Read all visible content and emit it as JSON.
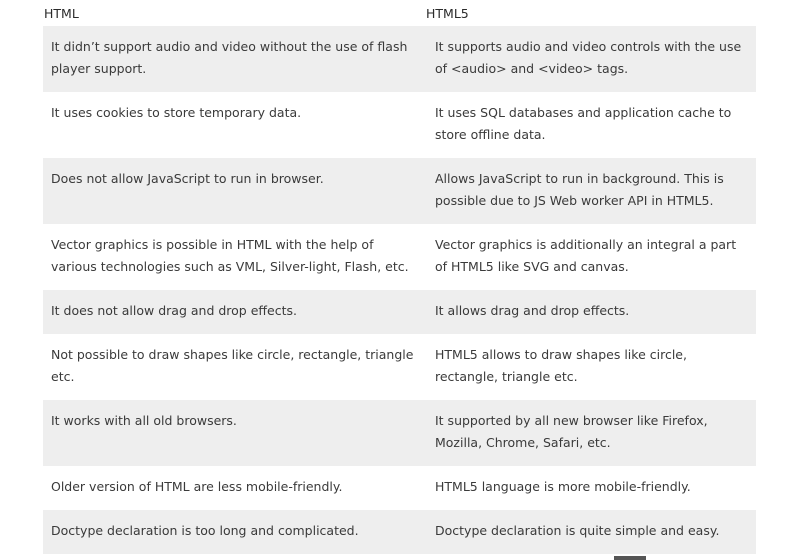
{
  "table": {
    "headers": [
      "HTML",
      "HTML5"
    ],
    "rows": [
      [
        "It didn’t support audio and video without the use of flash player support.",
        "It supports audio and video controls with the use of <audio> and <video> tags."
      ],
      [
        "It uses cookies to store temporary data.",
        "It uses SQL databases and application cache to store offline data."
      ],
      [
        "Does not allow JavaScript to run in browser.",
        "Allows JavaScript to run in background. This is possible due to JS Web worker API in HTML5."
      ],
      [
        "Vector graphics is possible in HTML with the help of various technologies such as VML, Silver-light, Flash, etc.",
        "Vector graphics is additionally an integral a part of HTML5 like SVG and canvas."
      ],
      [
        "It does not allow drag and drop effects.",
        "It allows drag and drop effects."
      ],
      [
        "Not possible to draw shapes like circle, rectangle, triangle etc.",
        "HTML5 allows to draw shapes like circle, rectangle, triangle etc."
      ],
      [
        "It works with all old browsers.",
        "It supported by all new browser like Firefox, Mozilla, Chrome, Safari, etc."
      ],
      [
        "Older version of HTML are less mobile-friendly.",
        "HTML5 language is more mobile-friendly."
      ],
      [
        "Doctype declaration is too long and complicated.",
        "Doctype declaration is quite simple and easy."
      ]
    ]
  }
}
